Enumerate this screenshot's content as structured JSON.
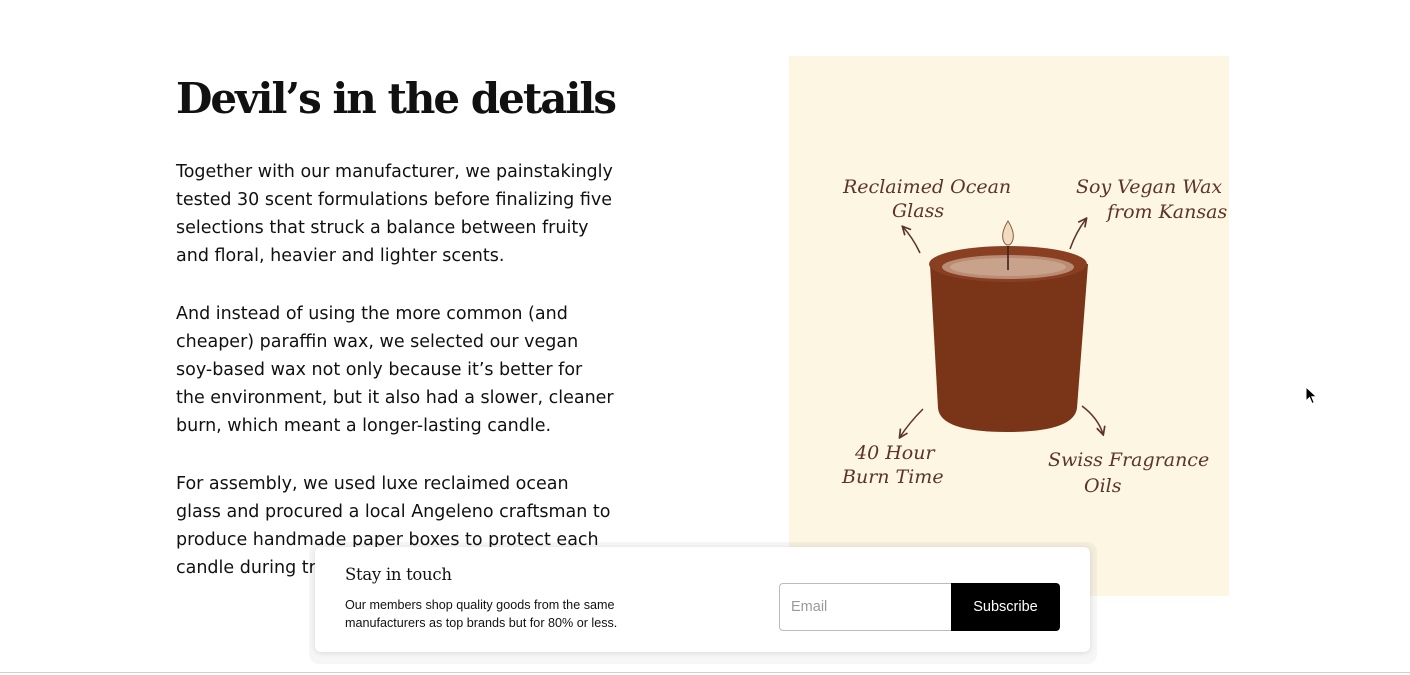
{
  "section": {
    "headline": "Devil’s in the details",
    "paragraphs": [
      "Together with our manufacturer, we painstakingly tested 30 scent formulations before finalizing five selections that struck a balance between fruity and floral, heavier and lighter scents.",
      "And instead of using the more common (and cheaper) paraffin wax, we selected our vegan soy-based wax not only because it’s better for the environment, but it also had a slower, cleaner burn, which meant a longer-lasting candle.",
      "For assembly, we used luxe reclaimed ocean glass and procured a local Angeleno craftsman to produce handmade paper boxes to protect each candle during transit."
    ]
  },
  "illustration": {
    "background": "#fdf6e3",
    "candle_color": "#7a3418",
    "labels": {
      "top_left": [
        "Reclaimed Ocean",
        "Glass"
      ],
      "top_right": [
        "Soy Vegan Wax",
        "from Kansas"
      ],
      "bottom_left": [
        "40 Hour",
        "Burn Time"
      ],
      "bottom_right": [
        "Swiss Fragrance",
        "Oils"
      ]
    }
  },
  "newsletter": {
    "title": "Stay in touch",
    "description": "Our members shop quality goods from the same manufacturers as top brands but for 80% or less.",
    "email_placeholder": "Email",
    "email_value": "",
    "subscribe_label": "Subscribe"
  }
}
